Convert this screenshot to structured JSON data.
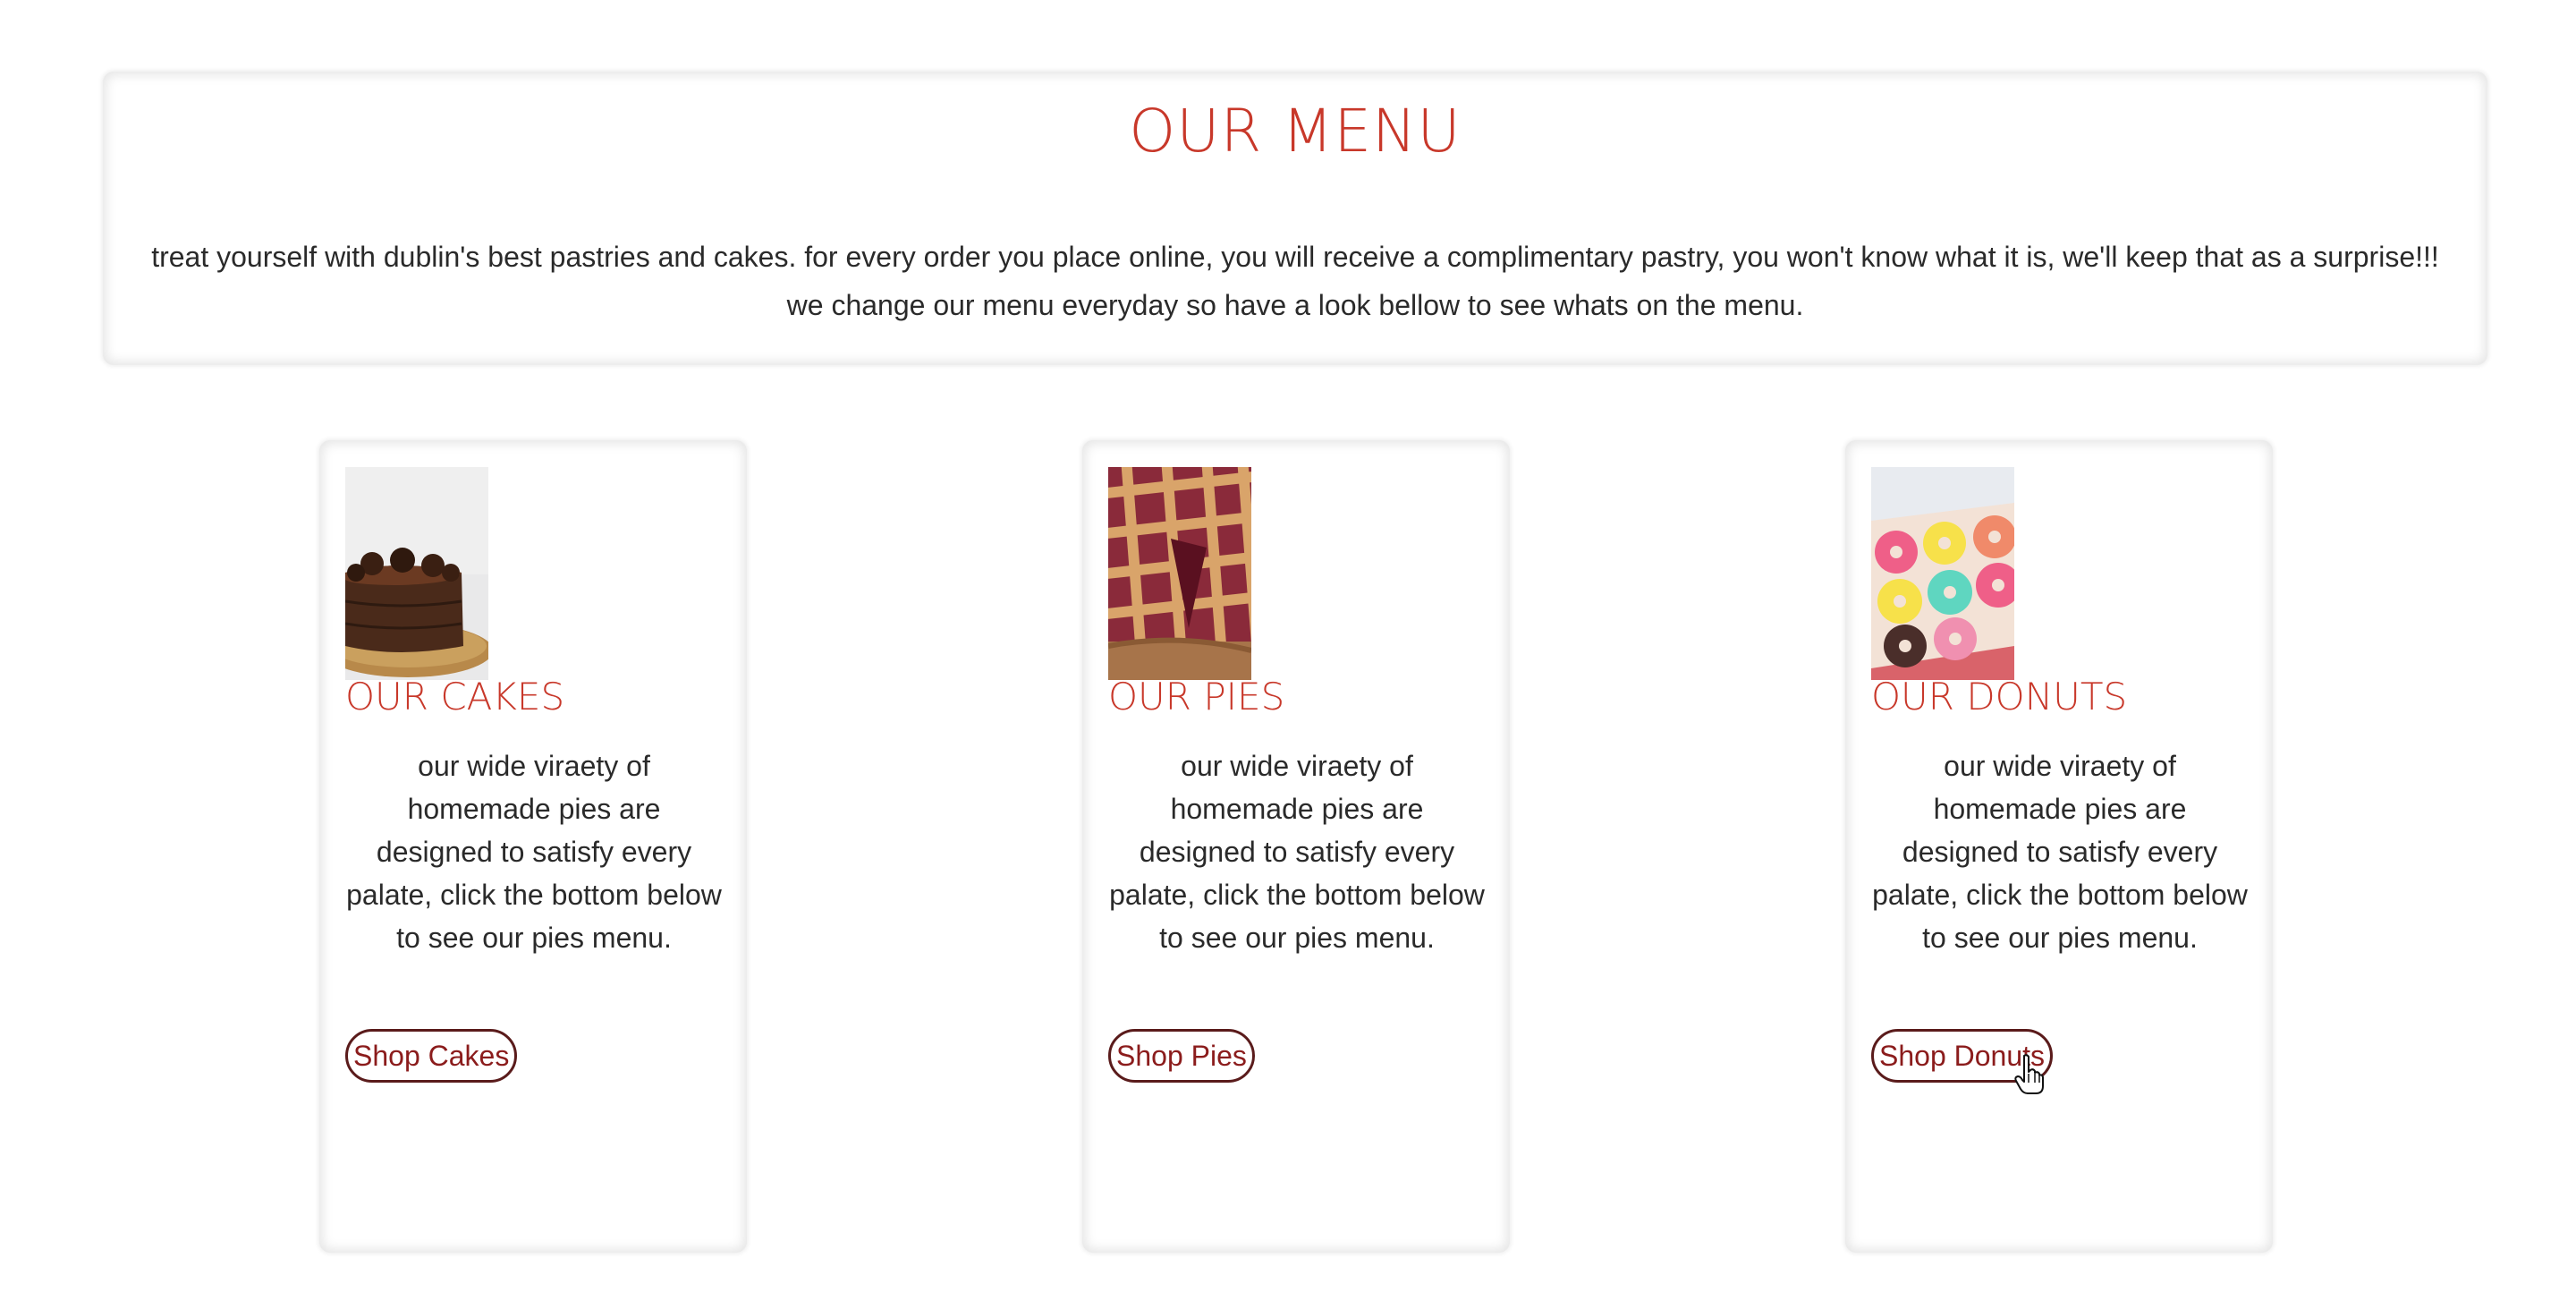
{
  "hero": {
    "title": "OUR MENU",
    "text": "treat yourself with dublin's best pastries and cakes. for every order you place online, you will receive a complimentary pastry, you won't know what it is, we'll keep that as a surprise!!! we change our menu everyday so have a look bellow to see whats on the menu."
  },
  "cards": [
    {
      "title": "OUR CAKES",
      "text": "our wide viraety of homemade pies are designed to satisfy every palate, click the bottom below to see our pies menu.",
      "button": "Shop Cakes",
      "image": "chocolate-cake-photo"
    },
    {
      "title": "OUR PIES",
      "text": "our wide viraety of homemade pies are designed to satisfy every palate, click the bottom below to see our pies menu.",
      "button": "Shop Pies",
      "image": "lattice-pie-photo"
    },
    {
      "title": "OUR DONUTS",
      "text": "our wide viraety of homemade pies are designed to satisfy every palate, click the bottom below to see our pies menu.",
      "button": "Shop Donuts",
      "image": "donuts-box-photo"
    }
  ],
  "colors": {
    "heading": "#c8382a",
    "button_text": "#8b1c1c",
    "button_border": "#5a1b1b",
    "body_text": "#2a2a2a"
  }
}
